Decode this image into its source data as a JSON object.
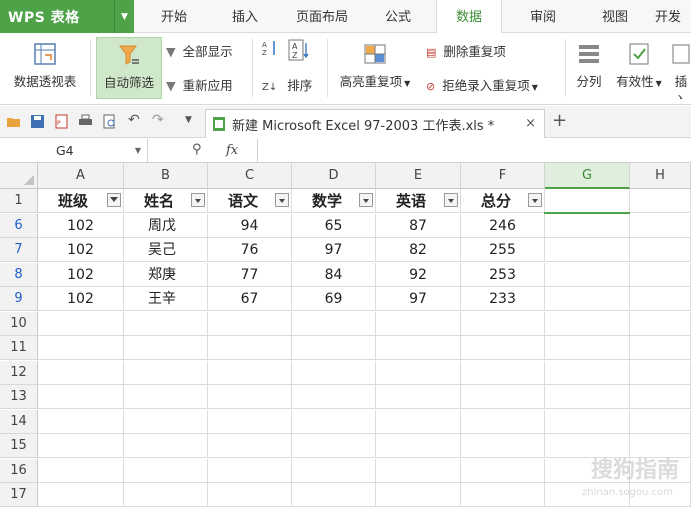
{
  "app": {
    "logo": "WPS 表格"
  },
  "menu": {
    "tabs": [
      "开始",
      "插入",
      "页面布局",
      "公式",
      "数据",
      "审阅",
      "视图",
      "开发"
    ],
    "active": "数据"
  },
  "ribbon": {
    "pivot": "数据透视表",
    "autofilter": "自动筛选",
    "show_all": "全部显示",
    "reapply": "重新应用",
    "sort": "排序",
    "highlight_dup": "高亮重复项",
    "remove_dup": "删除重复项",
    "reject_dup": "拒绝录入重复项",
    "split": "分列",
    "validity": "有效性",
    "insert": "插入"
  },
  "document": {
    "tab_title": "新建 Microsoft Excel 97-2003 工作表.xls *"
  },
  "formula_bar": {
    "cell_ref": "G4",
    "fx": "fx"
  },
  "sheet": {
    "columns": [
      "A",
      "B",
      "C",
      "D",
      "E",
      "F",
      "G",
      "H"
    ],
    "selected_column": "G",
    "headers": [
      "班级",
      "姓名",
      "语文",
      "数学",
      "英语",
      "总分"
    ],
    "rows": [
      {
        "num": "6",
        "cells": [
          "102",
          "周戊",
          "94",
          "65",
          "87",
          "246"
        ]
      },
      {
        "num": "7",
        "cells": [
          "102",
          "吴己",
          "76",
          "97",
          "82",
          "255"
        ]
      },
      {
        "num": "8",
        "cells": [
          "102",
          "郑庚",
          "77",
          "84",
          "92",
          "253"
        ]
      },
      {
        "num": "9",
        "cells": [
          "102",
          "王辛",
          "67",
          "69",
          "97",
          "233"
        ]
      }
    ],
    "empty_rows": [
      "10",
      "11",
      "12",
      "13",
      "14",
      "15",
      "16",
      "17"
    ]
  },
  "watermark": {
    "text": "搜狗指南",
    "sub": "zhinan.sogou.com"
  },
  "colors": {
    "accent": "#4ea248",
    "filtered_row": "#1f5fc7"
  }
}
